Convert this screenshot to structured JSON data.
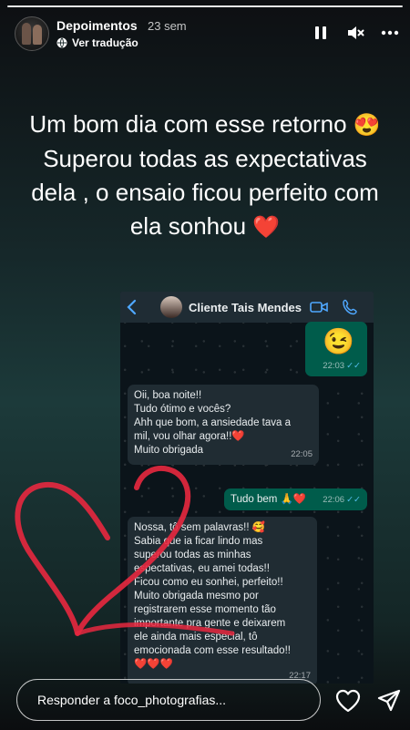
{
  "header": {
    "username": "Depoimentos",
    "time_ago": "23 sem",
    "translate_label": "Ver tradução"
  },
  "caption": {
    "line1": "Um bom dia com esse retorno",
    "line1_emoji": "😍",
    "line2": "Superou todas as expectativas",
    "line3": "dela , o ensaio ficou perfeito com",
    "line4": "ela sonhou",
    "line4_emoji": "❤️"
  },
  "chat": {
    "contact_name": "Cliente Tais Mendes",
    "messages": [
      {
        "direction": "out",
        "text": "😉",
        "time": "22:03"
      },
      {
        "direction": "in",
        "lines": [
          "Oii, boa noite!!",
          "Tudo ótimo e vocês?",
          "Ahh que bom, a ansiedade tava a",
          "mil, vou olhar agora!!❤️",
          "Muito obrigada"
        ],
        "time": "22:05"
      },
      {
        "direction": "out",
        "text": "Tudo bem 🙏❤️",
        "time": "22:06"
      },
      {
        "direction": "in",
        "lines": [
          "Nossa, tô sem palavras!! 🥰",
          "Sabia que ia ficar lindo mas",
          "superou todas as minhas",
          "espectativas, eu amei todas!!",
          "Ficou como eu sonhei, perfeito!!",
          "Muito obrigada mesmo por",
          "registrarem esse momento tão",
          "importante pra gente e deixarem",
          "ele ainda mais especial, tô",
          "emocionada com esse resultado!!",
          "❤️❤️❤️"
        ],
        "time": "22:17"
      }
    ]
  },
  "reply": {
    "placeholder": "Responder a foco_photografias..."
  },
  "colors": {
    "chat_bg": "#0b141a",
    "bubble_in": "#202c33",
    "bubble_out": "#005c4b",
    "read_ticks": "#53bdeb",
    "heart_drawing": "#e8283f"
  },
  "icons": [
    "pause-icon",
    "mute-icon",
    "more-icon",
    "globe-icon",
    "back-arrow-icon",
    "video-call-icon",
    "phone-icon",
    "heart-icon",
    "send-icon"
  ]
}
